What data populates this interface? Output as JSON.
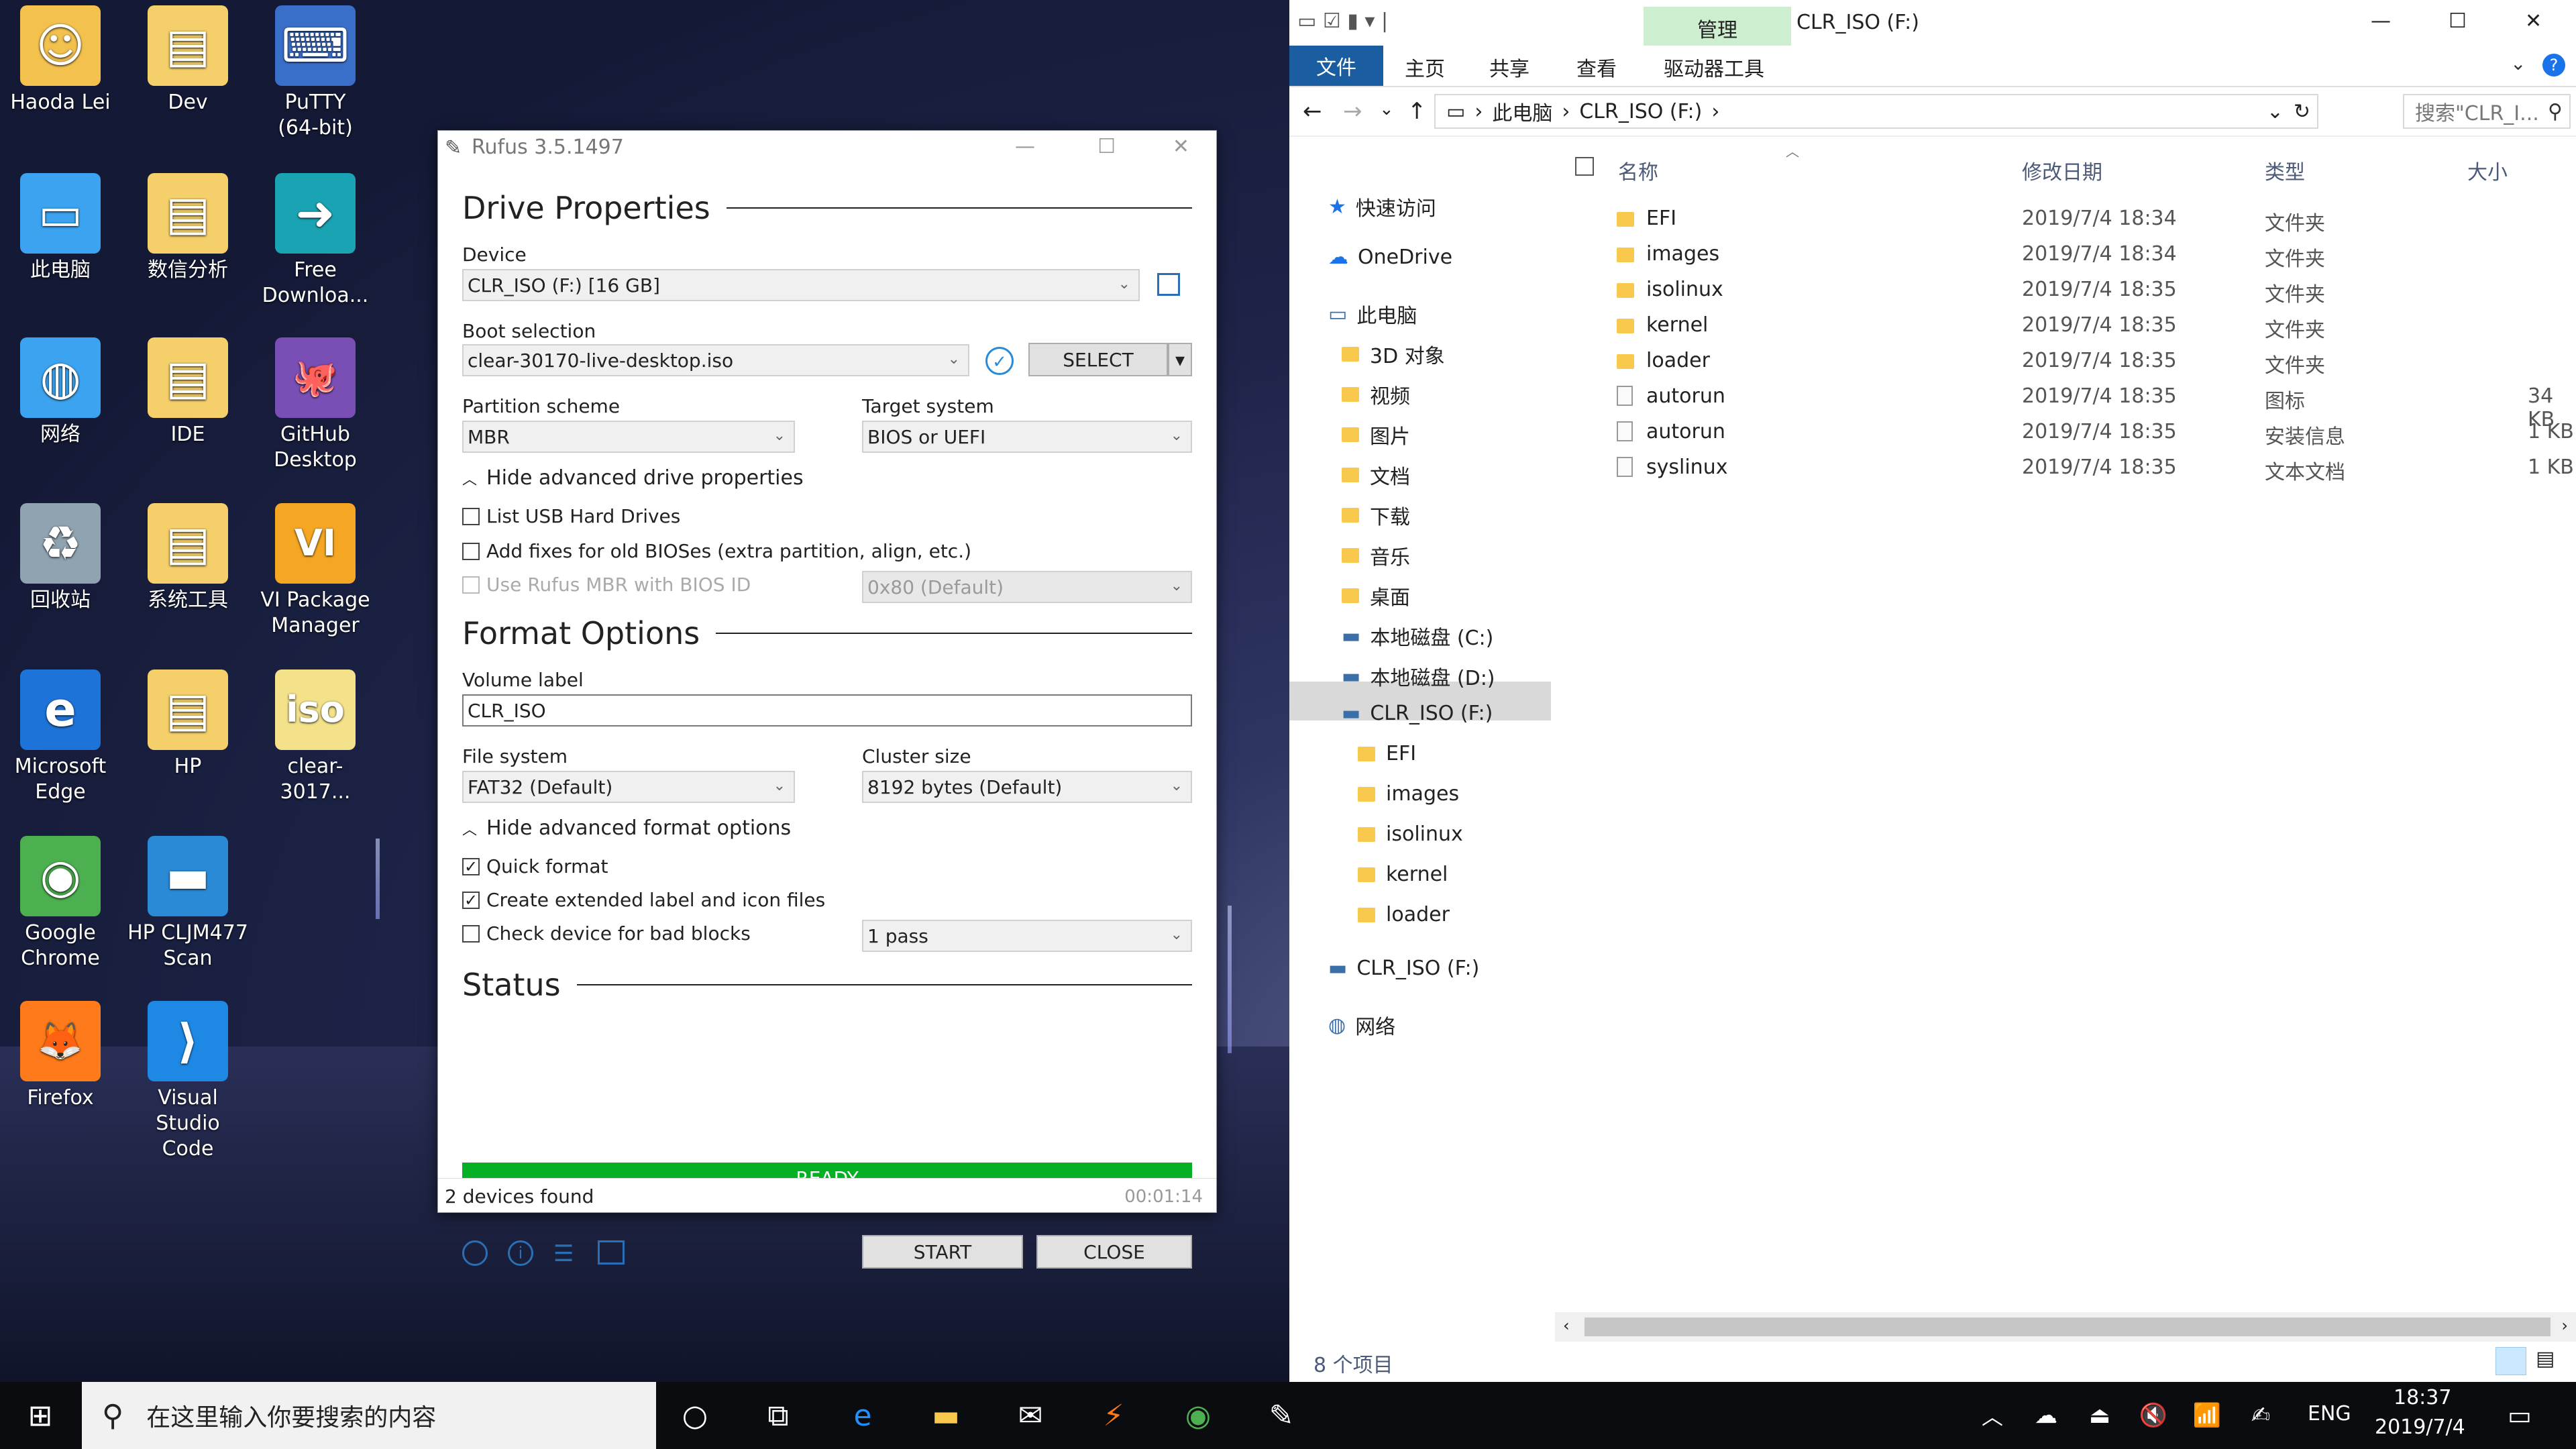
{
  "desktop_icons": [
    {
      "label": "Haoda Lei",
      "icon": "user-folder-icon"
    },
    {
      "label": "Dev",
      "icon": "folder-icon"
    },
    {
      "label": "PuTTY\n(64-bit)",
      "icon": "putty-icon"
    },
    {
      "label": "此电脑",
      "icon": "computer-icon"
    },
    {
      "label": "数信分析",
      "icon": "folder-icon"
    },
    {
      "label": "Free\nDownloa...",
      "icon": "free-download-icon"
    },
    {
      "label": "网络",
      "icon": "network-icon"
    },
    {
      "label": "IDE",
      "icon": "folder-icon"
    },
    {
      "label": "GitHub\nDesktop",
      "icon": "github-icon"
    },
    {
      "label": "回收站",
      "icon": "recycle-bin-icon"
    },
    {
      "label": "系统工具",
      "icon": "folder-icon"
    },
    {
      "label": "VI Package\nManager",
      "icon": "vi-package-icon"
    },
    {
      "label": "Microsoft\nEdge",
      "icon": "edge-icon"
    },
    {
      "label": "HP",
      "icon": "folder-icon"
    },
    {
      "label": "clear-3017...",
      "icon": "iso-file-icon"
    },
    {
      "label": "Google\nChrome",
      "icon": "chrome-icon"
    },
    {
      "label": "HP CLJM477\nScan",
      "icon": "scanner-icon"
    },
    {
      "label": "Firefox",
      "icon": "firefox-icon"
    },
    {
      "label": "Visual Studio\nCode",
      "icon": "vscode-icon"
    }
  ],
  "rufus": {
    "title": "Rufus 3.5.1497",
    "drive_properties": "Drive Properties",
    "device_label": "Device",
    "device_value": "CLR_ISO (F:) [16 GB]",
    "boot_label": "Boot selection",
    "boot_value": "clear-30170-live-desktop.iso",
    "select_btn": "SELECT",
    "partition_label": "Partition scheme",
    "partition_value": "MBR",
    "target_label": "Target system",
    "target_value": "BIOS or UEFI",
    "hide_drive": "Hide advanced drive properties",
    "list_usb": "List USB Hard Drives",
    "add_fixes": "Add fixes for old BIOSes (extra partition, align, etc.)",
    "use_mbr": "Use Rufus MBR with BIOS ID",
    "bios_id": "0x80 (Default)",
    "format_options": "Format Options",
    "volume_label_lbl": "Volume label",
    "volume_label_value": "CLR_ISO",
    "fs_label": "File system",
    "fs_value": "FAT32 (Default)",
    "cluster_label": "Cluster size",
    "cluster_value": "8192 bytes (Default)",
    "hide_format": "Hide advanced format options",
    "quick_format": "Quick format",
    "ext_label": "Create extended label and icon files",
    "bad_blocks": "Check device for bad blocks",
    "passes": "1 pass",
    "status": "Status",
    "ready": "READY",
    "start_btn": "START",
    "close_btn": "CLOSE",
    "devices_found": "2 devices found",
    "timer": "00:01:14"
  },
  "explorer": {
    "title": "CLR_ISO (F:)",
    "manage_tab": "管理",
    "tabs": [
      "文件",
      "主页",
      "共享",
      "查看",
      "驱动器工具"
    ],
    "breadcrumb": [
      "此电脑",
      "CLR_ISO (F:)"
    ],
    "search_placeholder": "搜索\"CLR_I...",
    "columns": {
      "name": "名称",
      "date": "修改日期",
      "type": "类型",
      "size": "大小"
    },
    "tree": [
      {
        "label": "快速访问",
        "icon": "star-icon"
      },
      {
        "label": "OneDrive",
        "icon": "cloud-icon"
      },
      {
        "label": "此电脑",
        "icon": "computer-icon"
      },
      {
        "label": "3D 对象",
        "icon": "folder-icon"
      },
      {
        "label": "视频",
        "icon": "folder-icon"
      },
      {
        "label": "图片",
        "icon": "folder-icon"
      },
      {
        "label": "文档",
        "icon": "folder-icon"
      },
      {
        "label": "下载",
        "icon": "folder-icon"
      },
      {
        "label": "音乐",
        "icon": "folder-icon"
      },
      {
        "label": "桌面",
        "icon": "folder-icon"
      },
      {
        "label": "本地磁盘 (C:)",
        "icon": "drive-icon"
      },
      {
        "label": "本地磁盘 (D:)",
        "icon": "drive-icon"
      },
      {
        "label": "CLR_ISO (F:)",
        "icon": "usb-drive-icon"
      },
      {
        "label": "EFI",
        "icon": "folder-icon"
      },
      {
        "label": "images",
        "icon": "folder-icon"
      },
      {
        "label": "isolinux",
        "icon": "folder-icon"
      },
      {
        "label": "kernel",
        "icon": "folder-icon"
      },
      {
        "label": "loader",
        "icon": "folder-icon"
      },
      {
        "label": "CLR_ISO (F:)",
        "icon": "usb-drive-icon"
      },
      {
        "label": "网络",
        "icon": "network-icon"
      }
    ],
    "files": [
      {
        "name": "EFI",
        "date": "2019/7/4 18:34",
        "type": "文件夹",
        "size": ""
      },
      {
        "name": "images",
        "date": "2019/7/4 18:34",
        "type": "文件夹",
        "size": ""
      },
      {
        "name": "isolinux",
        "date": "2019/7/4 18:35",
        "type": "文件夹",
        "size": ""
      },
      {
        "name": "kernel",
        "date": "2019/7/4 18:35",
        "type": "文件夹",
        "size": ""
      },
      {
        "name": "loader",
        "date": "2019/7/4 18:35",
        "type": "文件夹",
        "size": ""
      },
      {
        "name": "autorun",
        "date": "2019/7/4 18:35",
        "type": "图标",
        "size": "34 KB"
      },
      {
        "name": "autorun",
        "date": "2019/7/4 18:35",
        "type": "安装信息",
        "size": "1 KB"
      },
      {
        "name": "syslinux",
        "date": "2019/7/4 18:35",
        "type": "文本文档",
        "size": "1 KB"
      }
    ],
    "item_count": "8 个项目"
  },
  "taskbar": {
    "search_placeholder": "在这里输入你要搜索的内容",
    "lang": "ENG",
    "time": "18:37",
    "date": "2019/7/4"
  }
}
